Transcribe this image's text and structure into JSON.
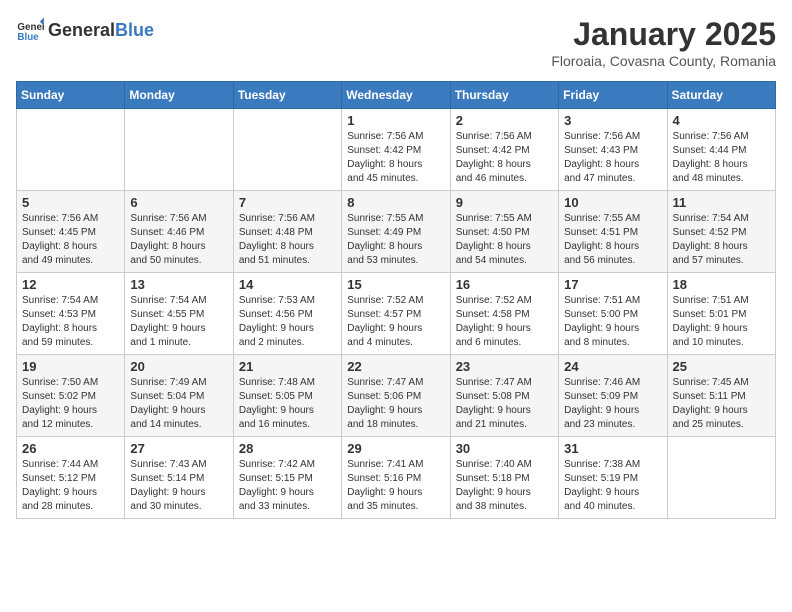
{
  "logo": {
    "general": "General",
    "blue": "Blue"
  },
  "title": "January 2025",
  "location": "Floroaia, Covasna County, Romania",
  "headers": [
    "Sunday",
    "Monday",
    "Tuesday",
    "Wednesday",
    "Thursday",
    "Friday",
    "Saturday"
  ],
  "weeks": [
    [
      {
        "day": "",
        "info": ""
      },
      {
        "day": "",
        "info": ""
      },
      {
        "day": "",
        "info": ""
      },
      {
        "day": "1",
        "info": "Sunrise: 7:56 AM\nSunset: 4:42 PM\nDaylight: 8 hours\nand 45 minutes."
      },
      {
        "day": "2",
        "info": "Sunrise: 7:56 AM\nSunset: 4:42 PM\nDaylight: 8 hours\nand 46 minutes."
      },
      {
        "day": "3",
        "info": "Sunrise: 7:56 AM\nSunset: 4:43 PM\nDaylight: 8 hours\nand 47 minutes."
      },
      {
        "day": "4",
        "info": "Sunrise: 7:56 AM\nSunset: 4:44 PM\nDaylight: 8 hours\nand 48 minutes."
      }
    ],
    [
      {
        "day": "5",
        "info": "Sunrise: 7:56 AM\nSunset: 4:45 PM\nDaylight: 8 hours\nand 49 minutes."
      },
      {
        "day": "6",
        "info": "Sunrise: 7:56 AM\nSunset: 4:46 PM\nDaylight: 8 hours\nand 50 minutes."
      },
      {
        "day": "7",
        "info": "Sunrise: 7:56 AM\nSunset: 4:48 PM\nDaylight: 8 hours\nand 51 minutes."
      },
      {
        "day": "8",
        "info": "Sunrise: 7:55 AM\nSunset: 4:49 PM\nDaylight: 8 hours\nand 53 minutes."
      },
      {
        "day": "9",
        "info": "Sunrise: 7:55 AM\nSunset: 4:50 PM\nDaylight: 8 hours\nand 54 minutes."
      },
      {
        "day": "10",
        "info": "Sunrise: 7:55 AM\nSunset: 4:51 PM\nDaylight: 8 hours\nand 56 minutes."
      },
      {
        "day": "11",
        "info": "Sunrise: 7:54 AM\nSunset: 4:52 PM\nDaylight: 8 hours\nand 57 minutes."
      }
    ],
    [
      {
        "day": "12",
        "info": "Sunrise: 7:54 AM\nSunset: 4:53 PM\nDaylight: 8 hours\nand 59 minutes."
      },
      {
        "day": "13",
        "info": "Sunrise: 7:54 AM\nSunset: 4:55 PM\nDaylight: 9 hours\nand 1 minute."
      },
      {
        "day": "14",
        "info": "Sunrise: 7:53 AM\nSunset: 4:56 PM\nDaylight: 9 hours\nand 2 minutes."
      },
      {
        "day": "15",
        "info": "Sunrise: 7:52 AM\nSunset: 4:57 PM\nDaylight: 9 hours\nand 4 minutes."
      },
      {
        "day": "16",
        "info": "Sunrise: 7:52 AM\nSunset: 4:58 PM\nDaylight: 9 hours\nand 6 minutes."
      },
      {
        "day": "17",
        "info": "Sunrise: 7:51 AM\nSunset: 5:00 PM\nDaylight: 9 hours\nand 8 minutes."
      },
      {
        "day": "18",
        "info": "Sunrise: 7:51 AM\nSunset: 5:01 PM\nDaylight: 9 hours\nand 10 minutes."
      }
    ],
    [
      {
        "day": "19",
        "info": "Sunrise: 7:50 AM\nSunset: 5:02 PM\nDaylight: 9 hours\nand 12 minutes."
      },
      {
        "day": "20",
        "info": "Sunrise: 7:49 AM\nSunset: 5:04 PM\nDaylight: 9 hours\nand 14 minutes."
      },
      {
        "day": "21",
        "info": "Sunrise: 7:48 AM\nSunset: 5:05 PM\nDaylight: 9 hours\nand 16 minutes."
      },
      {
        "day": "22",
        "info": "Sunrise: 7:47 AM\nSunset: 5:06 PM\nDaylight: 9 hours\nand 18 minutes."
      },
      {
        "day": "23",
        "info": "Sunrise: 7:47 AM\nSunset: 5:08 PM\nDaylight: 9 hours\nand 21 minutes."
      },
      {
        "day": "24",
        "info": "Sunrise: 7:46 AM\nSunset: 5:09 PM\nDaylight: 9 hours\nand 23 minutes."
      },
      {
        "day": "25",
        "info": "Sunrise: 7:45 AM\nSunset: 5:11 PM\nDaylight: 9 hours\nand 25 minutes."
      }
    ],
    [
      {
        "day": "26",
        "info": "Sunrise: 7:44 AM\nSunset: 5:12 PM\nDaylight: 9 hours\nand 28 minutes."
      },
      {
        "day": "27",
        "info": "Sunrise: 7:43 AM\nSunset: 5:14 PM\nDaylight: 9 hours\nand 30 minutes."
      },
      {
        "day": "28",
        "info": "Sunrise: 7:42 AM\nSunset: 5:15 PM\nDaylight: 9 hours\nand 33 minutes."
      },
      {
        "day": "29",
        "info": "Sunrise: 7:41 AM\nSunset: 5:16 PM\nDaylight: 9 hours\nand 35 minutes."
      },
      {
        "day": "30",
        "info": "Sunrise: 7:40 AM\nSunset: 5:18 PM\nDaylight: 9 hours\nand 38 minutes."
      },
      {
        "day": "31",
        "info": "Sunrise: 7:38 AM\nSunset: 5:19 PM\nDaylight: 9 hours\nand 40 minutes."
      },
      {
        "day": "",
        "info": ""
      }
    ]
  ]
}
